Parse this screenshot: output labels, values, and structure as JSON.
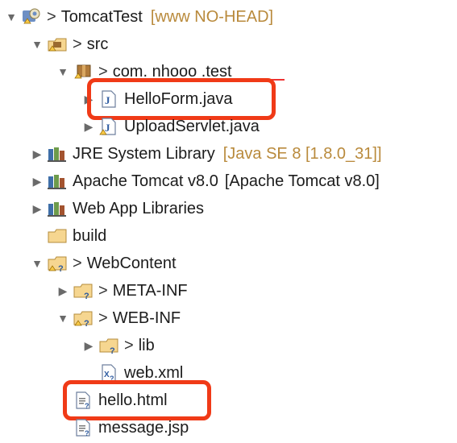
{
  "project": {
    "name": "TomcatTest",
    "decoration": "[www NO-HEAD]"
  },
  "tree": [
    {
      "id": "project",
      "label": "TomcatTest",
      "decoration": "[www NO-HEAD]",
      "prefix": ">",
      "expanded": true,
      "icon": "project-icon"
    },
    {
      "id": "src",
      "label": "src",
      "prefix": ">",
      "expanded": true,
      "icon": "source-folder-icon"
    },
    {
      "id": "pkg",
      "label": "com. nhooo .test",
      "prefix": ">",
      "expanded": true,
      "icon": "package-icon"
    },
    {
      "id": "helloform",
      "label": "HelloForm.java",
      "expanded": false,
      "icon": "java-file-icon",
      "highlighted": true
    },
    {
      "id": "uploadservlet",
      "label": "UploadServlet.java",
      "expanded": false,
      "icon": "java-file-icon"
    },
    {
      "id": "jre",
      "label": "JRE System Library",
      "decoration": "[Java SE 8 [1.8.0_31]]",
      "expanded": false,
      "icon": "library-icon"
    },
    {
      "id": "tomcat",
      "label": "Apache Tomcat v8.0",
      "decoration": "[Apache Tomcat v8.0]",
      "expanded": false,
      "icon": "library-icon"
    },
    {
      "id": "webapplibs",
      "label": "Web App Libraries",
      "expanded": false,
      "icon": "library-icon"
    },
    {
      "id": "build",
      "label": "build",
      "icon": "folder-icon"
    },
    {
      "id": "webcontent",
      "label": "WebContent",
      "prefix": ">",
      "expanded": true,
      "icon": "folder-icon"
    },
    {
      "id": "metainf",
      "label": "META-INF",
      "prefix": ">",
      "expanded": false,
      "icon": "folder-icon"
    },
    {
      "id": "webinf",
      "label": "WEB-INF",
      "prefix": ">",
      "expanded": true,
      "icon": "folder-icon"
    },
    {
      "id": "lib",
      "label": "lib",
      "prefix": ">",
      "expanded": false,
      "icon": "folder-icon"
    },
    {
      "id": "webxml",
      "label": "web.xml",
      "icon": "xml-file-icon"
    },
    {
      "id": "hellohtml",
      "label": "hello.html",
      "icon": "html-file-icon",
      "highlighted": true
    },
    {
      "id": "messagejsp",
      "label": "message.jsp",
      "icon": "jsp-file-icon"
    }
  ],
  "colors": {
    "highlight": "#f03a17",
    "decoration": "#b98a3c",
    "text": "#1c1c1c"
  }
}
